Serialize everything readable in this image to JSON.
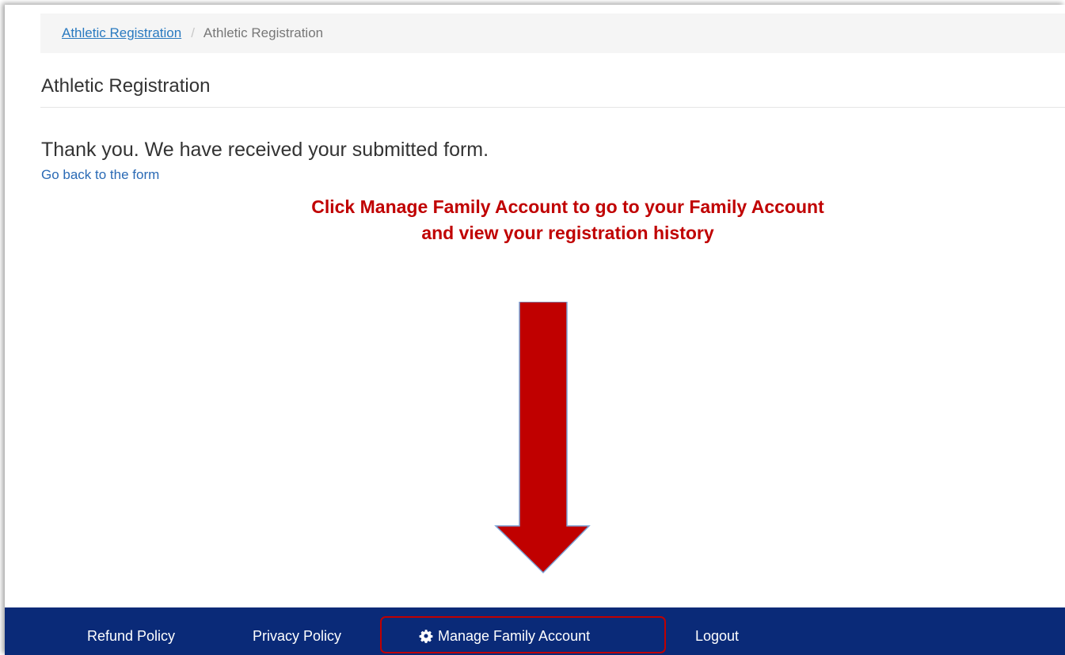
{
  "breadcrumb": {
    "link_label": "Athletic Registration",
    "separator": "/",
    "current_label": "Athletic Registration"
  },
  "page": {
    "title": "Athletic Registration",
    "message": "Thank you. We have received your submitted form.",
    "back_link": "Go back to the form"
  },
  "annotation": {
    "text": "Click Manage Family Account to go to your Family Account and view your registration history",
    "color": "#c00000",
    "arrow_icon": "down-arrow-icon"
  },
  "footer": {
    "background": "#0a2a78",
    "links": {
      "refund": "Refund Policy",
      "privacy": "Privacy Policy",
      "manage": "Manage Family Account",
      "manage_icon": "gear-icon",
      "logout": "Logout"
    },
    "highlight_color": "#c00000"
  }
}
